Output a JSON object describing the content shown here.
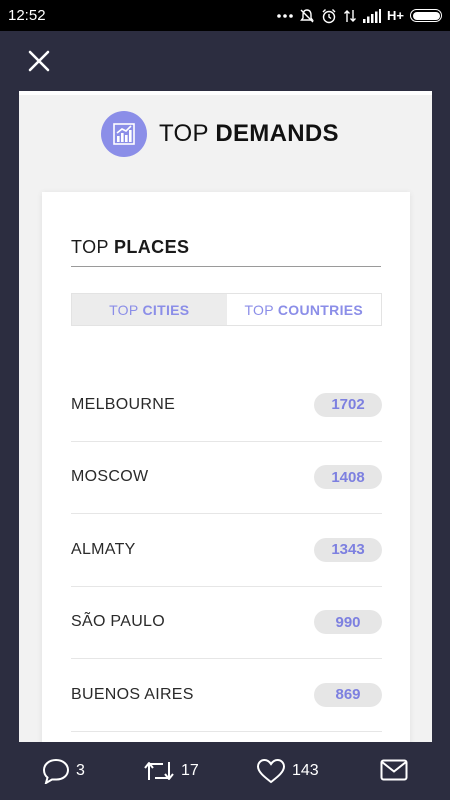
{
  "status_bar": {
    "time": "12:52",
    "network": "H+"
  },
  "header": {
    "title_light": "TOP",
    "title_bold": "DEMANDS"
  },
  "panel": {
    "title_light": "TOP",
    "title_bold": "PLACES",
    "tabs": [
      {
        "light": "TOP",
        "bold": "CITIES",
        "active": true
      },
      {
        "light": "TOP",
        "bold": "COUNTRIES",
        "active": false
      }
    ],
    "items": [
      {
        "name": "MELBOURNE",
        "count": "1702"
      },
      {
        "name": "MOSCOW",
        "count": "1408"
      },
      {
        "name": "ALMATY",
        "count": "1343"
      },
      {
        "name": "SÃO PAULO",
        "count": "990"
      },
      {
        "name": "BUENOS AIRES",
        "count": "869"
      }
    ]
  },
  "actions": {
    "replies": "3",
    "retweets": "17",
    "likes": "143"
  },
  "colors": {
    "accent": "#8b8ee8",
    "backdrop": "#2c2d40"
  },
  "icons": [
    "more-icon",
    "notifications-off-icon",
    "alarm-icon",
    "data-icon",
    "signal-icon",
    "battery-icon",
    "close-icon",
    "chart-icon",
    "reply-icon",
    "retweet-icon",
    "like-icon",
    "message-icon"
  ]
}
